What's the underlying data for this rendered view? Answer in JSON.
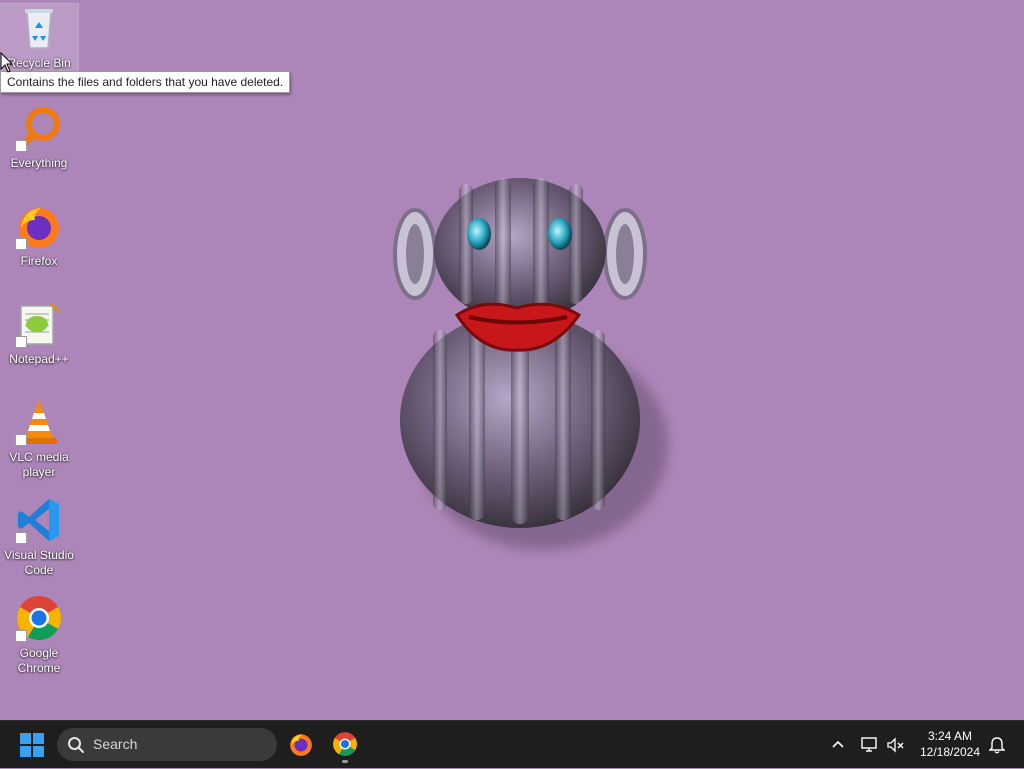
{
  "desktop": {
    "icons": [
      {
        "label": "Recycle Bin",
        "icon": "recycle-bin-icon"
      },
      {
        "label": "Everything",
        "icon": "everything-search-icon"
      },
      {
        "label": "Firefox",
        "icon": "firefox-icon"
      },
      {
        "label": "Notepad++",
        "icon": "notepad-plus-plus-icon"
      },
      {
        "label": "VLC media player",
        "icon": "vlc-cone-icon"
      },
      {
        "label": "Visual Studio Code",
        "icon": "vscode-icon"
      },
      {
        "label": "Google Chrome",
        "icon": "chrome-icon"
      }
    ],
    "tooltip": "Contains the files and folders that you have deleted."
  },
  "taskbar": {
    "search_placeholder": "Search",
    "pinned": [
      {
        "name": "Firefox",
        "icon": "firefox-icon"
      },
      {
        "name": "Google Chrome",
        "icon": "chrome-icon",
        "running": true
      }
    ],
    "tray": {
      "icons": [
        "chevron-up-icon",
        "network-icon",
        "volume-muted-icon",
        "notification-bell-icon"
      ]
    },
    "clock": {
      "time": "3:24 AM",
      "date": "12/18/2024"
    }
  },
  "colors": {
    "wallpaper": "#ad86b9",
    "taskbar": "#1e1e1e",
    "search_box": "#3a3a3a",
    "windows_blue": "#1e90e8"
  }
}
